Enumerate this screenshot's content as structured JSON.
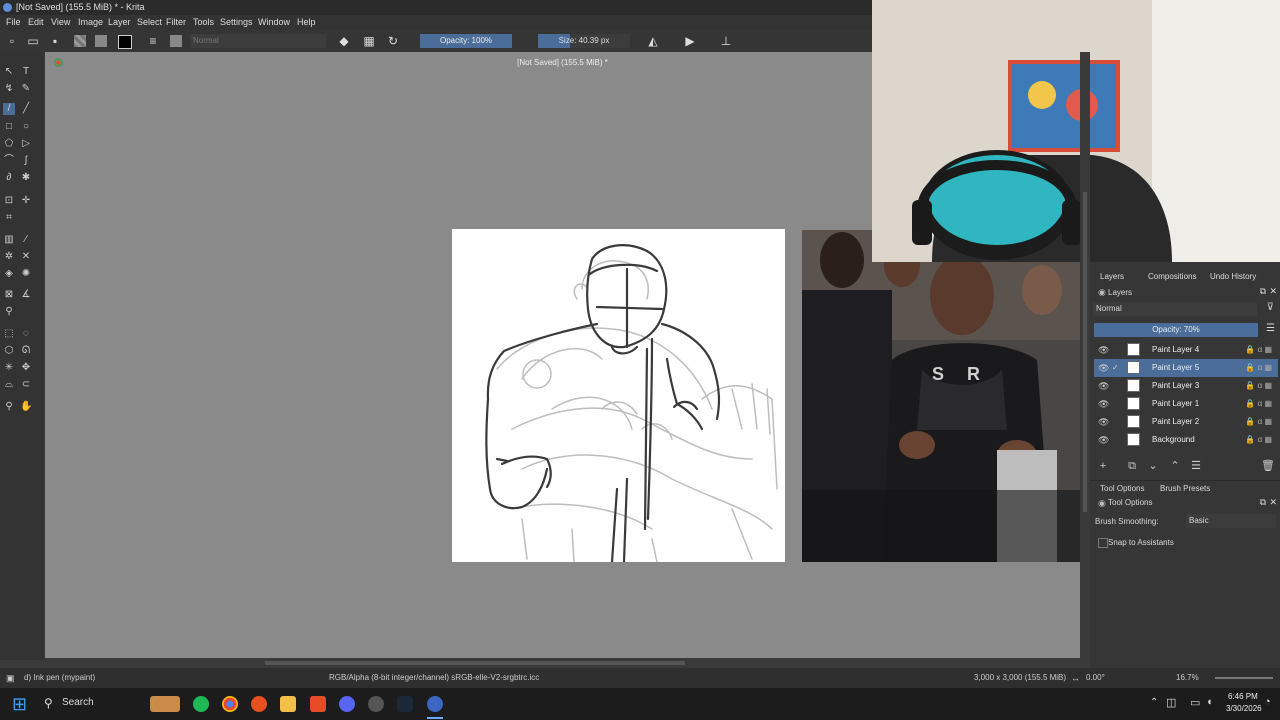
{
  "window": {
    "title": "[Not Saved]  (155.5 MiB) * - Krita"
  },
  "menu": [
    "File",
    "Edit",
    "View",
    "Image",
    "Layer",
    "Select",
    "Filter",
    "Tools",
    "Settings",
    "Window",
    "Help"
  ],
  "toolbar": {
    "blend_mode": "Normal",
    "opacity_label": "Opacity: 100%",
    "size_label": "Size: 40.39 px",
    "size_fraction": 0.35
  },
  "canvas": {
    "doc_label": "[Not Saved]  (155.5 MiB) *"
  },
  "docker": {
    "tabs": [
      "Layers",
      "Compositions",
      "Undo History"
    ],
    "layers_title": "Layers",
    "blend_mode": "Normal",
    "opacity_label": "Opacity:  70%",
    "layers": [
      {
        "name": "Paint Layer 4",
        "selected": false
      },
      {
        "name": "Paint Layer 5",
        "selected": true
      },
      {
        "name": "Paint Layer 3",
        "selected": false
      },
      {
        "name": "Paint Layer 1",
        "selected": false
      },
      {
        "name": "Paint Layer 2",
        "selected": false
      },
      {
        "name": "Background",
        "selected": false
      }
    ],
    "tool_tabs": [
      "Tool Options",
      "Brush Presets"
    ],
    "tool_options_title": "Tool Options",
    "brush_smoothing_label": "Brush Smoothing:",
    "brush_smoothing_value": "Basic",
    "snap_label": "Snap to Assistants"
  },
  "status": {
    "brush": "d) Ink pen (mypaint)",
    "color_profile": "RGB/Alpha (8-bit integer/channel)  sRGB-elle-V2-srgbtrc.icc",
    "dimensions": "3,000 x 3,000 (155.5 MiB)",
    "rotation": "0.00°",
    "zoom": "16.7%"
  },
  "taskbar": {
    "search": "Search",
    "time": "6:46 PM",
    "date": "3/30/2026"
  },
  "colors": {
    "accent": "#4a6d9a",
    "canvas_bg": "#8a8a8a"
  }
}
